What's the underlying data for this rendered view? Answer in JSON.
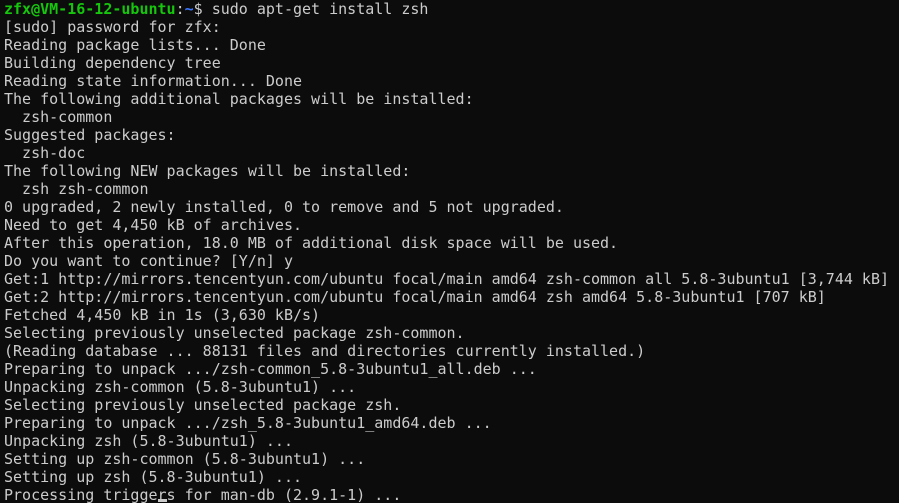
{
  "prompt": {
    "user_host": "zfx@VM-16-12-ubuntu",
    "separator": ":",
    "path": "~",
    "symbol": "$",
    "command": " sudo apt-get install zsh"
  },
  "output_lines": [
    "[sudo] password for zfx:",
    "Reading package lists... Done",
    "Building dependency tree",
    "Reading state information... Done",
    "The following additional packages will be installed:",
    "  zsh-common",
    "Suggested packages:",
    "  zsh-doc",
    "The following NEW packages will be installed:",
    "  zsh zsh-common",
    "0 upgraded, 2 newly installed, 0 to remove and 5 not upgraded.",
    "Need to get 4,450 kB of archives.",
    "After this operation, 18.0 MB of additional disk space will be used.",
    "Do you want to continue? [Y/n] y",
    "Get:1 http://mirrors.tencentyun.com/ubuntu focal/main amd64 zsh-common all 5.8-3ubuntu1 [3,744 kB]",
    "Get:2 http://mirrors.tencentyun.com/ubuntu focal/main amd64 zsh amd64 5.8-3ubuntu1 [707 kB]",
    "Fetched 4,450 kB in 1s (3,630 kB/s)",
    "Selecting previously unselected package zsh-common.",
    "(Reading database ... 88131 files and directories currently installed.)",
    "Preparing to unpack .../zsh-common_5.8-3ubuntu1_all.deb ...",
    "Unpacking zsh-common (5.8-3ubuntu1) ...",
    "Selecting previously unselected package zsh.",
    "Preparing to unpack .../zsh_5.8-3ubuntu1_amd64.deb ...",
    "Unpacking zsh (5.8-3ubuntu1) ...",
    "Setting up zsh-common (5.8-3ubuntu1) ...",
    "Setting up zsh (5.8-3ubuntu1) ...",
    "Processing triggers for man-db (2.9.1-1) ..."
  ],
  "colors": {
    "background": "#0c0c0c",
    "text": "#cccccc",
    "user_host": "#16c60c",
    "path": "#3b78ff"
  }
}
